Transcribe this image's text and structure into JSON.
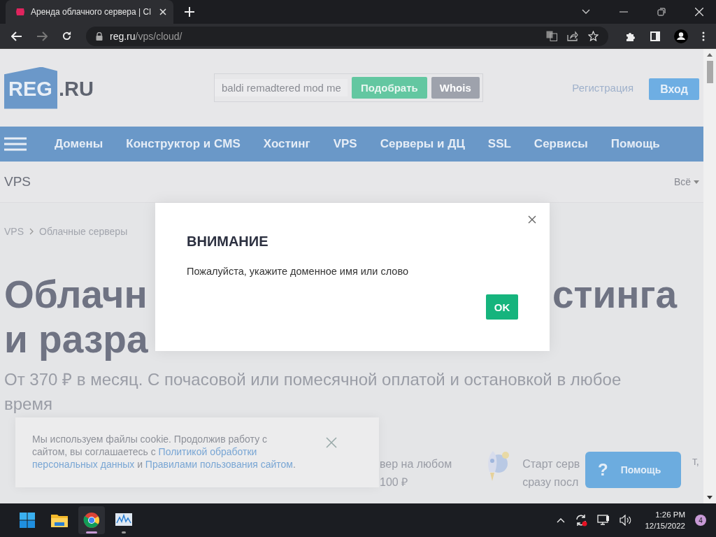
{
  "browser": {
    "tab_title": "Аренда облачного сервера | Cl",
    "url_host": "reg.ru",
    "url_path": "/vps/cloud/"
  },
  "header": {
    "logo_mark": "REG",
    "logo_suffix": ".RU",
    "search_value": "baldi remadtered mod me",
    "pick_button": "Подобрать",
    "whois_button": "Whois",
    "register_link": "Регистрация",
    "login_button": "Вход"
  },
  "nav": [
    "Домены",
    "Конструктор и CMS",
    "Хостинг",
    "VPS",
    "Серверы и ДЦ",
    "SSL",
    "Сервисы",
    "Помощь"
  ],
  "section": {
    "title": "VPS",
    "filter": "Всё"
  },
  "breadcrumbs": [
    "VPS",
    "Облачные серверы"
  ],
  "heading": {
    "line1_start": "Облачн",
    "line1_end": "стинга",
    "line2_start": "и разра"
  },
  "subtitle": "От 370 ₽ в месяц. С почасовой или помесячной оплатой и остановкой в любое время",
  "features": [
    {
      "kind": "text",
      "lines": [
        "вер на любом",
        "100 ₽"
      ]
    },
    {
      "kind": "rocket",
      "lines": [
        "Старт серв",
        "сразу посл"
      ]
    }
  ],
  "feature_tail": "т,",
  "dialog": {
    "title": "ВНИМАНИЕ",
    "message": "Пожалуйста, укажите доменное имя или слово",
    "ok_button": "OK"
  },
  "cookie": {
    "text": "Мы используем файлы cookie. Продолжив работу с сайтом, вы соглашаетесь с ",
    "link1": "Политикой обработки",
    "link1_cont": "персональных данных",
    "middle": " и ",
    "link2": "Правилами пользования сайтом",
    "end": "."
  },
  "help_button": {
    "icon": "?",
    "label": "Помощь"
  },
  "taskbar": {
    "apps": [
      {
        "kind": "windows",
        "open": false,
        "selected": false
      },
      {
        "kind": "folder",
        "open": false,
        "selected": false
      },
      {
        "kind": "chrome",
        "open": true,
        "selected": true
      },
      {
        "kind": "monitor",
        "open": true,
        "selected": false
      }
    ],
    "time": "1:26 PM",
    "date": "12/15/2022",
    "notifications": "4"
  }
}
